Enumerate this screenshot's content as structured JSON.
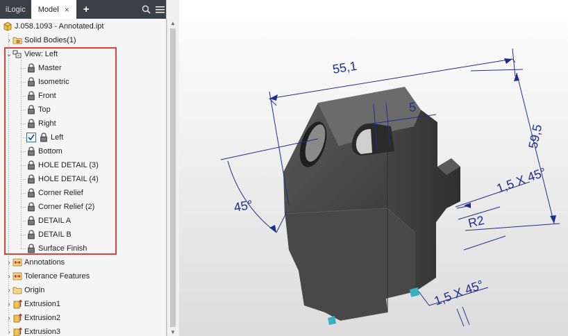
{
  "tabs": {
    "ilogic": "iLogic",
    "model": "Model",
    "close": "×",
    "add": "+"
  },
  "icons": {
    "search": "search-icon",
    "menu": "hamburger-menu-icon"
  },
  "tree": {
    "root": "J.058.1093 - Annotated.ipt",
    "solid_bodies": "Solid Bodies(1)",
    "view": "View: Left",
    "views": [
      "Master",
      "Isometric",
      "Front",
      "Top",
      "Right",
      "Left",
      "Bottom",
      "HOLE DETAIL (3)",
      "HOLE DETAIL (4)",
      "Corner Relief",
      "Corner Relief (2)",
      "DETAIL A",
      "DETAIL B",
      "Surface Finish"
    ],
    "active_view": "Left",
    "annotations": "Annotations",
    "tolerance_features": "Tolerance Features",
    "origin": "Origin",
    "extrusion1": "Extrusion1",
    "extrusion2": "Extrusion2",
    "extrusion3": "Extrusion3"
  },
  "dimensions": {
    "width": "55,1",
    "offset": "5",
    "height": "59,5",
    "chamfer_top": "1,5 X 45°",
    "angle": "45°",
    "radius": "R2",
    "chamfer_bottom": "1,5 X 45°"
  },
  "colors": {
    "highlight": "#d9413b",
    "dimension": "#1f2e8c",
    "tab_bar": "#3b4046"
  }
}
